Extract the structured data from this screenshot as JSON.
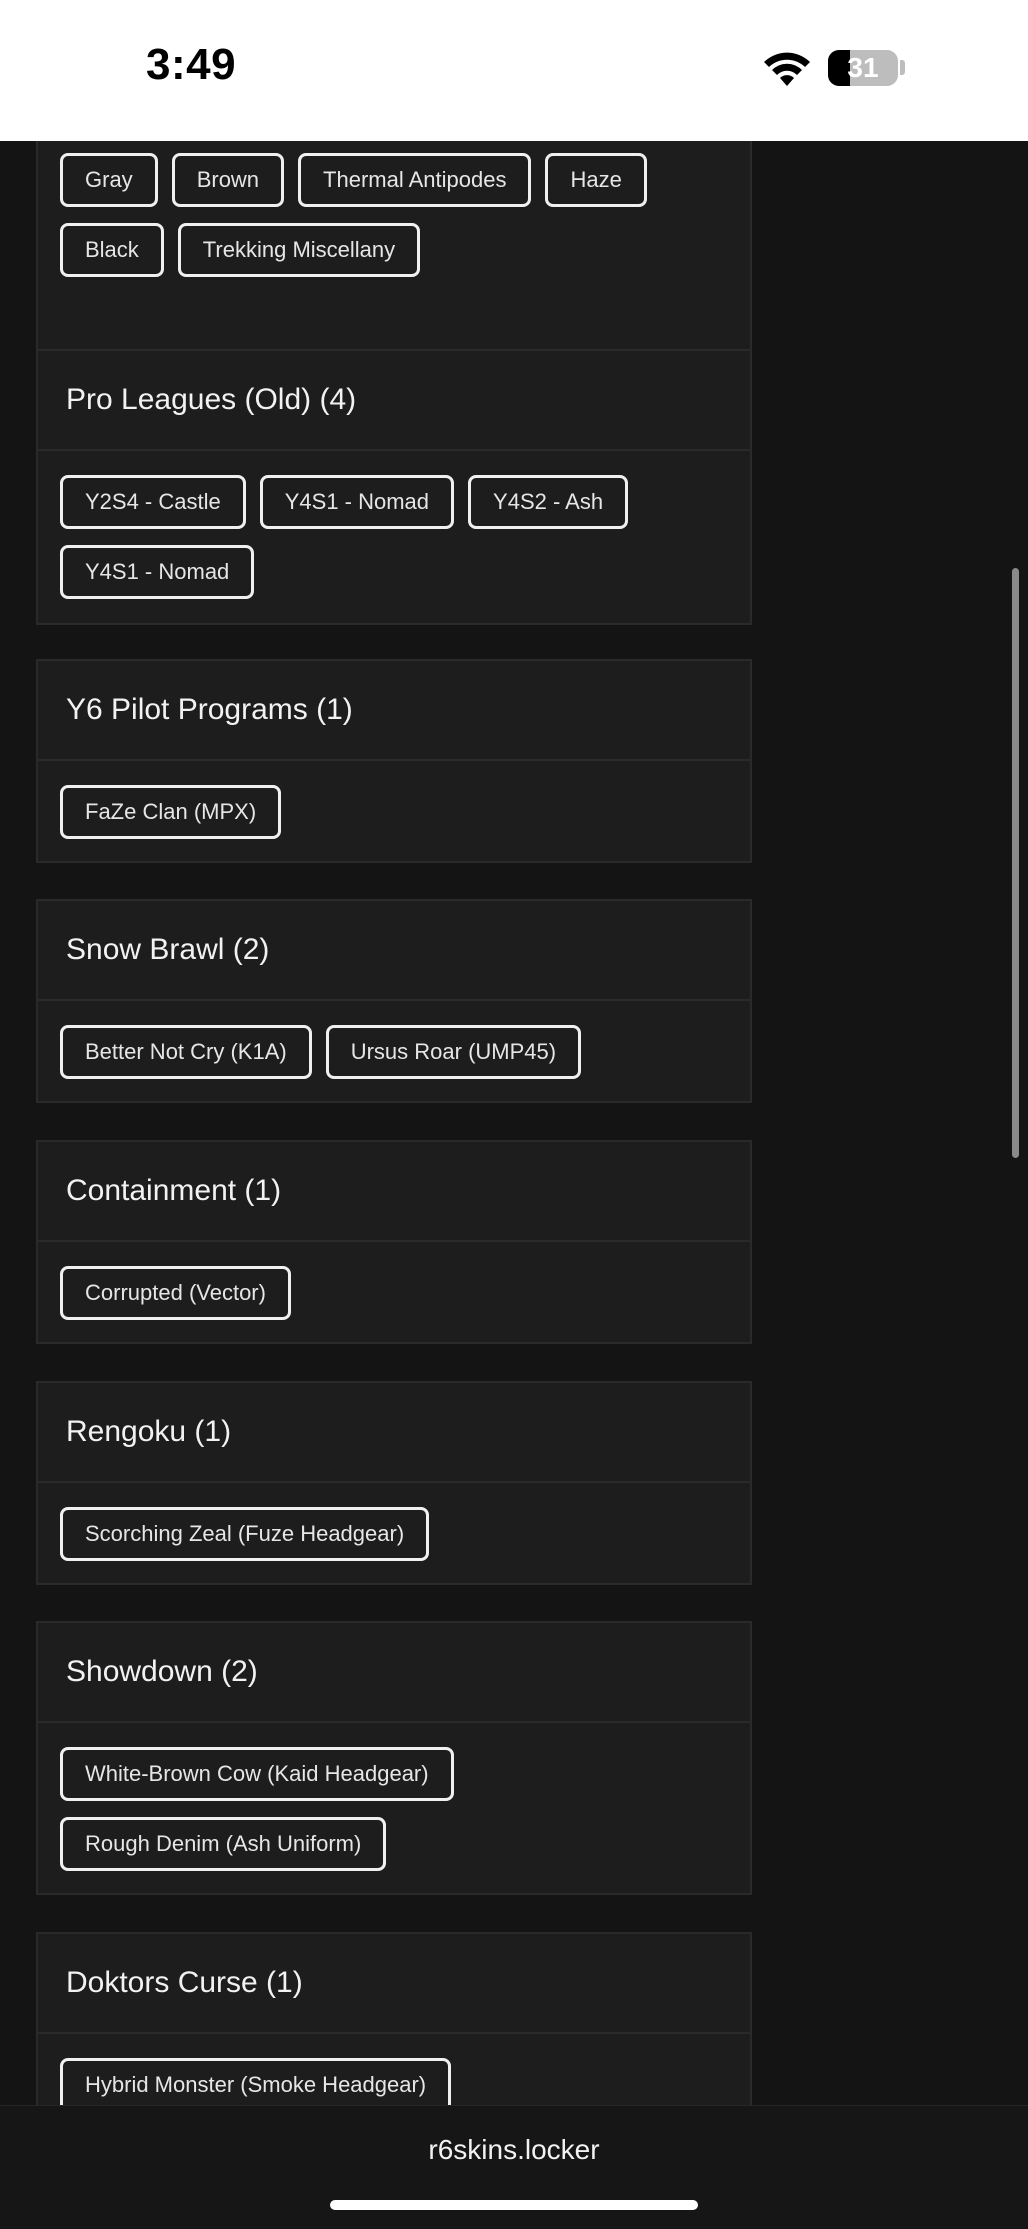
{
  "status_bar": {
    "time": "3:49",
    "battery": "31"
  },
  "sections": [
    {
      "title": "",
      "tags": [
        "Gray",
        "Brown",
        "Thermal Antipodes",
        "Haze",
        "Black",
        "Trekking Miscellany"
      ]
    },
    {
      "title": "Pro Leagues (Old) (4)",
      "tags": [
        "Y2S4 - Castle",
        "Y4S1 - Nomad",
        "Y4S2 - Ash",
        "Y4S1 - Nomad"
      ]
    },
    {
      "title": "Y6 Pilot Programs (1)",
      "tags": [
        "FaZe Clan (MPX)"
      ]
    },
    {
      "title": "Snow Brawl (2)",
      "tags": [
        "Better Not Cry (K1A)",
        "Ursus Roar (UMP45)"
      ]
    },
    {
      "title": "Containment (1)",
      "tags": [
        "Corrupted (Vector)"
      ]
    },
    {
      "title": "Rengoku (1)",
      "tags": [
        "Scorching Zeal (Fuze Headgear)"
      ]
    },
    {
      "title": "Showdown (2)",
      "tags": [
        "White-Brown Cow (Kaid Headgear)",
        "Rough Denim (Ash Uniform)"
      ]
    },
    {
      "title": "Doktors Curse (1)",
      "tags": [
        "Hybrid Monster (Smoke Headgear)"
      ]
    }
  ],
  "browser": {
    "url": "r6skins.locker"
  }
}
